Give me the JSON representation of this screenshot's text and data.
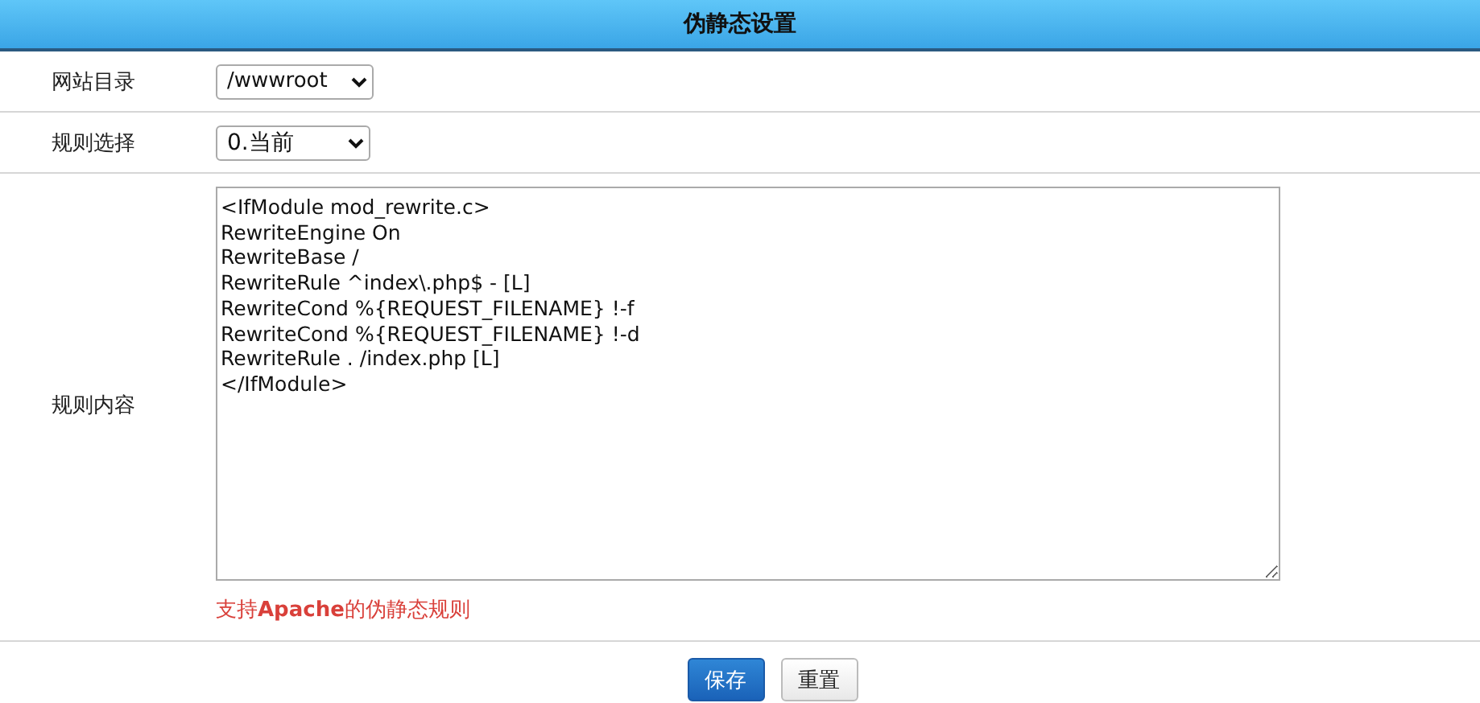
{
  "window": {
    "title": "伪静态设置"
  },
  "form": {
    "rows": [
      {
        "kind": "select",
        "label": "网站目录",
        "value": "/wwwroot"
      },
      {
        "kind": "select",
        "label": "规则选择",
        "value": "0.当前"
      },
      {
        "kind": "textarea",
        "label": "规则内容",
        "lines": [
          "<IfModule mod_rewrite.c>",
          "RewriteEngine On",
          "RewriteBase /",
          "RewriteRule ^index\\.php$ - [L]",
          "RewriteCond %{REQUEST_FILENAME} !-f",
          "RewriteCond %{REQUEST_FILENAME} !-d",
          "RewriteRule . /index.php [L]",
          "</IfModule>"
        ],
        "hint": "支持**Apache**的伪静态规则"
      }
    ]
  },
  "buttons": [
    {
      "label": "保存",
      "kind": "primary"
    },
    {
      "label": "重置",
      "kind": "default"
    }
  ]
}
